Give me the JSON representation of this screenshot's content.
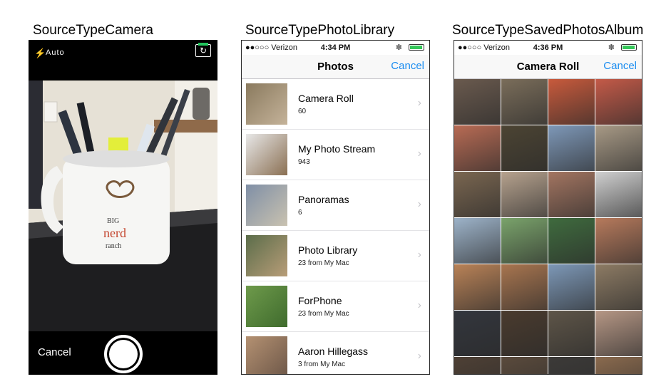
{
  "captions": {
    "camera": "SourceTypeCamera",
    "photo_library": "SourceTypePhotoLibrary",
    "saved_album": "SourceTypeSavedPhotosAlbum"
  },
  "camera": {
    "flash_mode": "Auto",
    "cancel_label": "Cancel",
    "mug_text_1": "BIG",
    "mug_text_2": "nerd",
    "mug_text_3": "ranch"
  },
  "photo_library": {
    "status": {
      "carrier": "●●○○○ Verizon",
      "time": "4:34 PM"
    },
    "nav": {
      "title": "Photos",
      "cancel_label": "Cancel"
    },
    "albums": [
      {
        "name": "Camera Roll",
        "count": "60",
        "colors": [
          "#8a7a5e",
          "#c5b39a"
        ]
      },
      {
        "name": "My Photo Stream",
        "count": "943",
        "colors": [
          "#e8e8e8",
          "#8a6f52"
        ]
      },
      {
        "name": "Panoramas",
        "count": "6",
        "colors": [
          "#7f8fa6",
          "#c9c2b0"
        ]
      },
      {
        "name": "Photo Library",
        "count": "23 from My Mac",
        "colors": [
          "#5b6d4a",
          "#b89d78"
        ]
      },
      {
        "name": "ForPhone",
        "count": "23 from My Mac",
        "colors": [
          "#6e9a4b",
          "#3f6b2d"
        ]
      },
      {
        "name": "Aaron Hillegass",
        "count": "3 from My Mac",
        "colors": [
          "#b49172",
          "#6d5748"
        ]
      }
    ]
  },
  "saved_album": {
    "status": {
      "carrier": "●●○○○ Verizon",
      "time": "4:36 PM"
    },
    "nav": {
      "title": "Camera Roll",
      "cancel_label": "Cancel"
    },
    "grid_colors": [
      [
        "#6a5a4e",
        "#7a6d5a",
        "#c85a3c",
        "#c45a48"
      ],
      [
        "#b86b54",
        "#4c4433",
        "#7e98b8",
        "#a89a86"
      ],
      [
        "#7a6650",
        "#b6a28e",
        "#a37561",
        "#d0d0d0"
      ],
      [
        "#9db3c9",
        "#7aa36b",
        "#3f6b3e",
        "#b77a5c"
      ],
      [
        "#b98257",
        "#a8754f",
        "#7d98b7",
        "#8d7b64"
      ],
      [
        "#33363d",
        "#4a3b2e",
        "#5e5548",
        "#b69785"
      ],
      [
        "#4e4035",
        "#5a4a3c",
        "#3c3a38",
        "#8a6a4e"
      ]
    ]
  }
}
